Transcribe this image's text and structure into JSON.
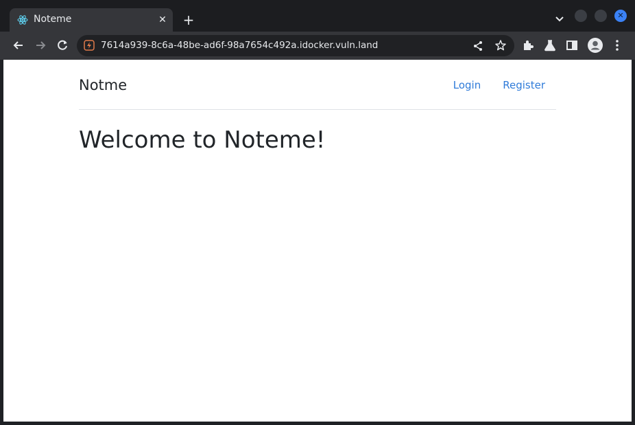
{
  "browser": {
    "tab": {
      "title": "Noteme",
      "favicon": "react-atom-icon",
      "favicon_color": "#61dafb"
    },
    "new_tab_icon": "plus-icon",
    "tab_search_icon": "chevron-down-icon",
    "window_controls": [
      "minimize-icon",
      "maximize-icon",
      "close-icon"
    ],
    "toolbar": {
      "back_icon": "back-arrow-icon",
      "forward_icon": "forward-arrow-icon",
      "reload_icon": "reload-icon",
      "url": "7614a939-8c6a-48be-ad6f-98a7654c492a.idocker.vuln.land",
      "site_icon": "lightning-badge-icon",
      "share_icon": "share-icon",
      "bookmark_icon": "star-icon",
      "extensions_icon": "puzzle-icon",
      "labs_icon": "flask-icon",
      "side_panel_icon": "side-panel-icon",
      "profile_icon": "profile-avatar-icon",
      "menu_icon": "kebab-menu-icon"
    },
    "colors": {
      "frame": "#1c1d20",
      "toolbar": "#35363a",
      "omnibox": "#202124",
      "close_button": "#3b82f6"
    }
  },
  "page": {
    "brand": "Notme",
    "nav": {
      "login": "Login",
      "register": "Register"
    },
    "heading": "Welcome to Noteme!",
    "link_color": "#2f7bd9"
  }
}
